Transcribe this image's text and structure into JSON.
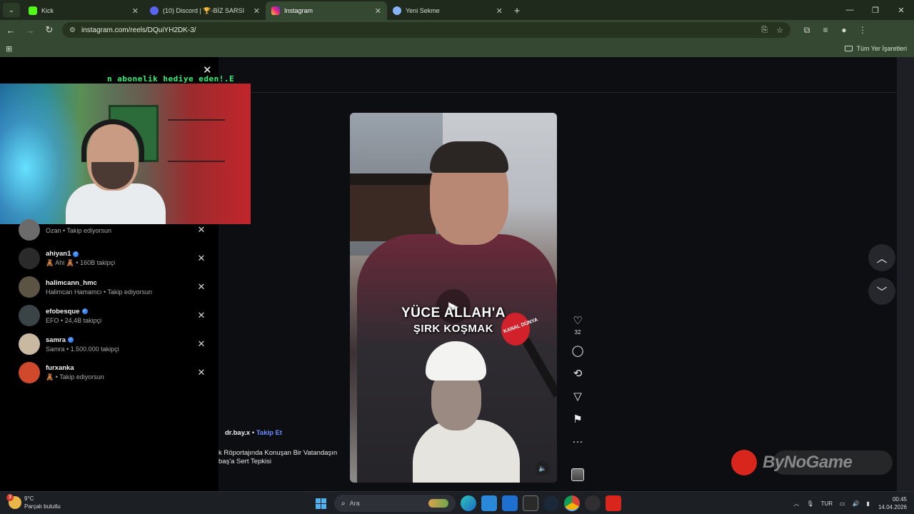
{
  "browser": {
    "tabs": [
      {
        "title": "Kick",
        "color": "#53fc18",
        "active": false
      },
      {
        "title": "(10) Discord | 🏆-BİZ SARSI",
        "color": "#5865f2",
        "active": false
      },
      {
        "title": "Instagram",
        "color": "#e1306c",
        "active": true
      },
      {
        "title": "Yeni Sekme",
        "color": "#8ab4f8",
        "active": false
      }
    ],
    "url": "instagram.com/reels/DQuiYH2DK-3/",
    "bookmarks_all": "Tüm Yer İşaretleri"
  },
  "stream": {
    "ticker": "n abonelik hediye eden!.E"
  },
  "suggestions": [
    {
      "username": "",
      "subtitle": "Ozan • Takip ediyorsun",
      "verified": false,
      "avatar": "#6b6b6b"
    },
    {
      "username": "ahiyan1",
      "subtitle": "🧸 Ahi 🧸 • 160B takipçi",
      "verified": true,
      "avatar": "#2a2a2a"
    },
    {
      "username": "halimcann_hmc",
      "subtitle": "Halimcan Hamamcı • Takip ediyorsun",
      "verified": false,
      "avatar": "#5b5444"
    },
    {
      "username": "efobesque",
      "subtitle": "EFO • 24,4B takipçi",
      "verified": true,
      "avatar": "#3a4346"
    },
    {
      "username": "samra",
      "subtitle": "Samra • 1.500.000 takipçi",
      "verified": true,
      "avatar": "#c9b9a3"
    },
    {
      "username": "furxanka",
      "subtitle": "🧸 • Takip ediyorsun",
      "verified": false,
      "avatar": "#d0492d"
    }
  ],
  "reel": {
    "caption_line1": "YÜCE ALLAH'A",
    "caption_line2": "ŞIRK KOŞMAK",
    "mic_label": "KANAL DÜNYA",
    "like_count": "32",
    "author": "dr.bay.x",
    "follow": "Takip Et",
    "description_line1": "k Röportajında Konuşan Bir Vatandaşın",
    "description_line2": "baş'a Sert Tepkisi"
  },
  "watermark": "ByNoGame",
  "taskbar": {
    "weather_temp": "9°C",
    "weather_desc": "Parçalı bulutlu",
    "weather_badge": "3",
    "search_placeholder": "Ara",
    "language": "TUR",
    "time": "00:45",
    "date": "14.04.2026"
  }
}
